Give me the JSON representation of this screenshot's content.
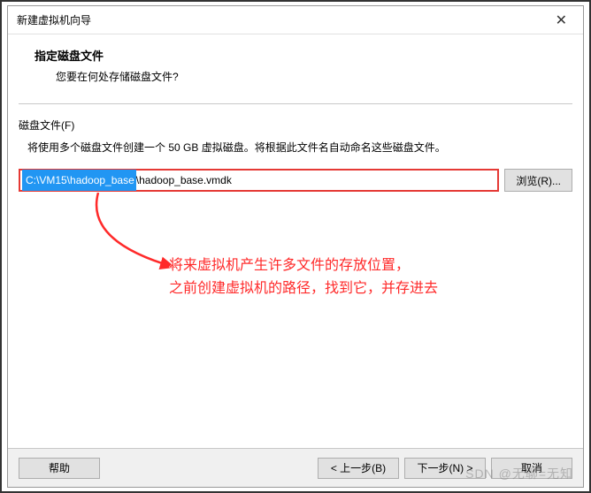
{
  "window": {
    "title": "新建虚拟机向导",
    "close_label": "✕"
  },
  "header": {
    "title": "指定磁盘文件",
    "subtitle": "您要在何处存储磁盘文件?"
  },
  "disk": {
    "field_label": "磁盘文件(F)",
    "description": "将使用多个磁盘文件创建一个 50 GB 虚拟磁盘。将根据此文件名自动命名这些磁盘文件。",
    "path_selected": "C:\\VM15\\hadoop_base",
    "path_rest": "\\hadoop_base.vmdk",
    "browse_label": "浏览(R)..."
  },
  "annotation": {
    "line1": "将来虚拟机产生许多文件的存放位置，",
    "line2": "之前创建虚拟机的路径，找到它，并存进去"
  },
  "footer": {
    "help": "帮助",
    "back": "< 上一步(B)",
    "next": "下一步(N) >",
    "cancel": "取消"
  },
  "watermark": "SDN @无聊=无知",
  "colors": {
    "annotation_red": "#ff2a2a",
    "highlight_red": "#e53935",
    "selection_blue": "#2196f3"
  }
}
